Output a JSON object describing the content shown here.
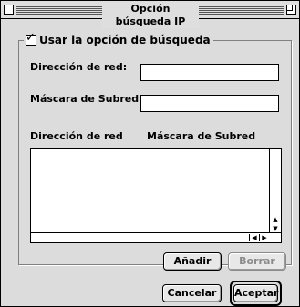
{
  "window": {
    "title": "Opción búsqueda IP"
  },
  "search_option": {
    "label": "Usar la opción de búsqueda",
    "checked": true
  },
  "network_address": {
    "label": "Dirección de red:",
    "value": ""
  },
  "subnet_mask": {
    "label": "Máscara de Subred:",
    "value": ""
  },
  "list": {
    "columns": [
      "Dirección de red",
      "Máscara de Subred"
    ],
    "rows": []
  },
  "buttons": {
    "add": "Añadir",
    "remove": "Borrar",
    "cancel": "Cancelar",
    "accept": "Aceptar"
  }
}
